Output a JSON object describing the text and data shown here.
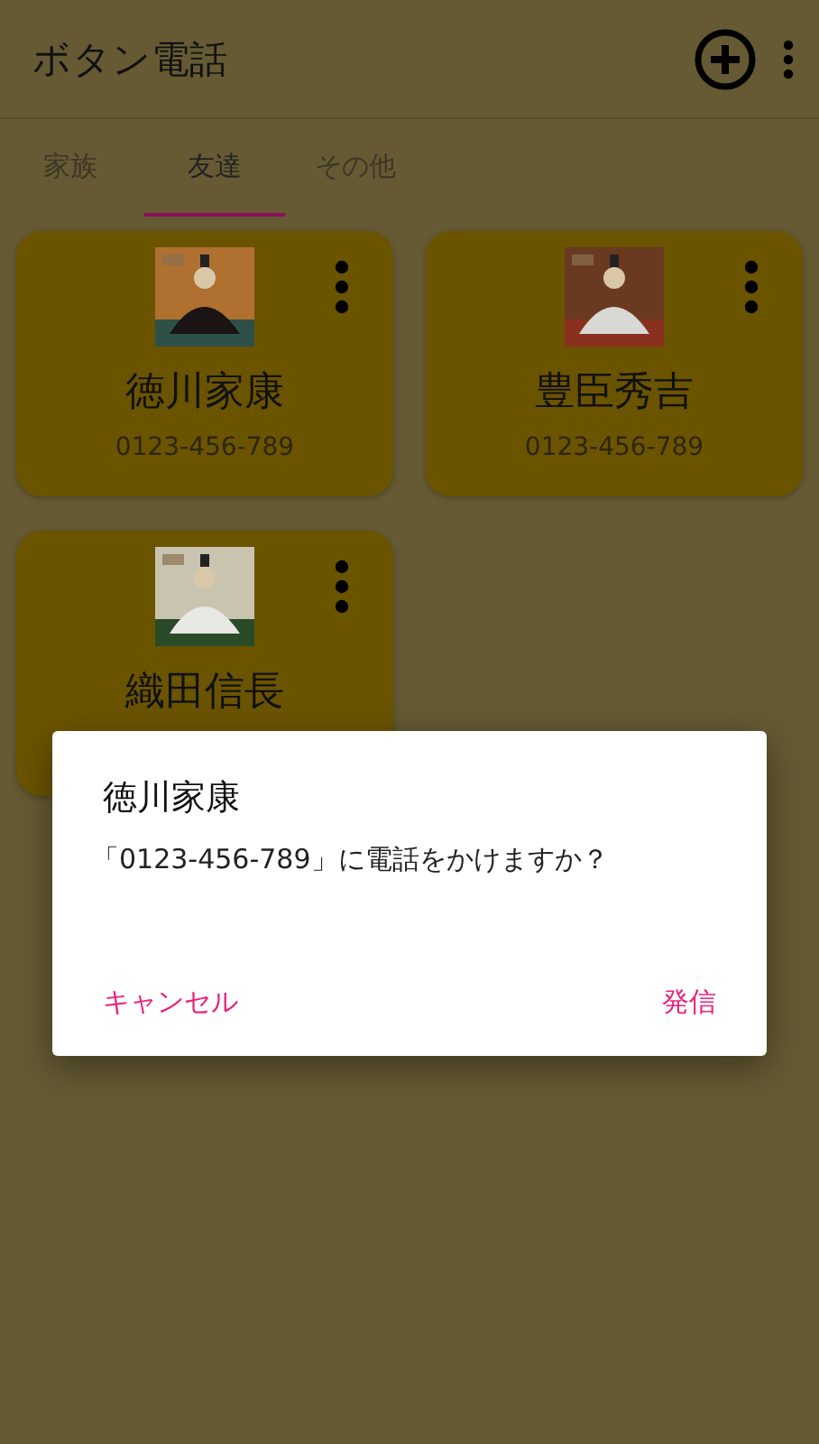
{
  "app_bar": {
    "title": "ボタン電話"
  },
  "tabs": [
    {
      "label": "家族",
      "selected": false
    },
    {
      "label": "友達",
      "selected": true
    },
    {
      "label": "その他",
      "selected": false
    }
  ],
  "contacts": [
    {
      "name": "徳川家康",
      "phone": "0123-456-789"
    },
    {
      "name": "豊臣秀吉",
      "phone": "0123-456-789"
    },
    {
      "name": "織田信長"
    }
  ],
  "dialog": {
    "title": "徳川家康",
    "message": "「0123-456-789」に電話をかけますか？",
    "buttons": [
      "キャンセル",
      "発信"
    ]
  }
}
